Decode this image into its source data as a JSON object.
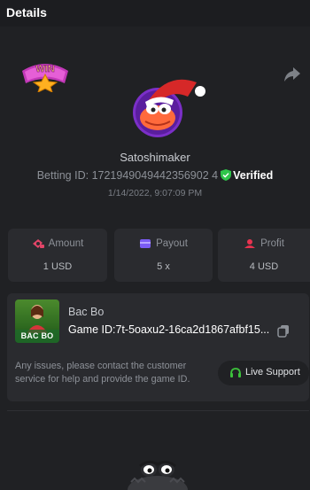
{
  "header": {
    "title": "Details"
  },
  "badge": {
    "text": "WIN"
  },
  "user": {
    "name": "Satoshimaker",
    "betting_id_label": "Betting ID:",
    "betting_id": "1721949049442356902",
    "betting_id_full": "1721949049442356902 4",
    "verified": "Verified",
    "timestamp": "1/14/2022, 9:07:09 PM"
  },
  "stats": [
    {
      "label": "Amount",
      "value": "1 USD",
      "icon": "money-icon",
      "color": "#e24568"
    },
    {
      "label": "Payout",
      "value": "5 x",
      "icon": "wallet-icon",
      "color": "#7b5cf5"
    },
    {
      "label": "Profit",
      "value": "4 USD",
      "icon": "profit-icon",
      "color": "#e8334f"
    }
  ],
  "game": {
    "thumb_label": "BAC BO",
    "name": "Bac Bo",
    "id_text": "Game ID:7t-5oaxu2-16ca2d1867afbf15...",
    "notice": "Any issues, please contact the customer service for help and provide the game ID.",
    "support_label": "Live Support",
    "support_color": "#3cc13b"
  },
  "colors": {
    "verified": "#2fc54a",
    "accent_red": "#e8334f"
  }
}
